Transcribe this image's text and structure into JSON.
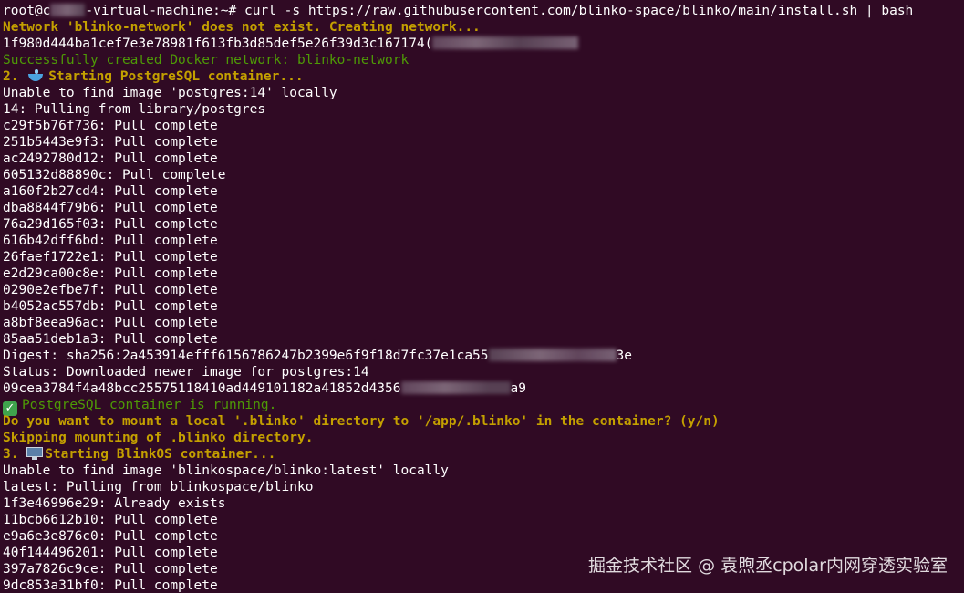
{
  "terminal": {
    "lines": [
      {
        "pre": "root@c",
        "post": "-virtual-machine:~# curl -s https://raw.githubusercontent.com/blinko-space/blinko/main/install.sh | bash"
      },
      {
        "text": "Network 'blinko-network' does not exist. Creating network..."
      },
      {
        "pre": "1f980d444ba1cef7e3e78981f613fb3d85def5e26f39d3c167174("
      },
      {
        "text": "Successfully created Docker network: blinko-network"
      },
      {
        "pre": "2. ",
        "post": "Starting PostgreSQL container..."
      },
      {
        "text": "Unable to find image 'postgres:14' locally"
      },
      {
        "text": "14: Pulling from library/postgres"
      },
      {
        "text": "c29f5b76f736: Pull complete"
      },
      {
        "text": "251b5443e9f3: Pull complete"
      },
      {
        "text": "ac2492780d12: Pull complete"
      },
      {
        "text": "605132d88890c: Pull complete"
      },
      {
        "text": "a160f2b27cd4: Pull complete"
      },
      {
        "text": "dba8844f79b6: Pull complete"
      },
      {
        "text": "76a29d165f03: Pull complete"
      },
      {
        "text": "616b42dff6bd: Pull complete"
      },
      {
        "text": "26faef1722e1: Pull complete"
      },
      {
        "text": "e2d29ca00c8e: Pull complete"
      },
      {
        "text": "0290e2efbe7f: Pull complete"
      },
      {
        "text": "b4052ac557db: Pull complete"
      },
      {
        "text": "a8bf8eea96ac: Pull complete"
      },
      {
        "text": "85aa51deb1a3: Pull complete"
      },
      {
        "pre": "Digest: sha256:2a453914efff6156786247b2399e6f9f18d7fc37e1ca55",
        "post": "3e"
      },
      {
        "text": "Status: Downloaded newer image for postgres:14"
      },
      {
        "pre": "09cea3784f4a48bcc25575118410ad449101182a41852d4356",
        "post": "a9"
      },
      {
        "text": "PostgreSQL container is running."
      },
      {
        "text": "Do you want to mount a local '.blinko' directory to '/app/.blinko' in the container? (y/n)"
      },
      {
        "text": "Skipping mounting of .blinko directory."
      },
      {
        "pre": "3. ",
        "post": "Starting BlinkOS container..."
      },
      {
        "text": "Unable to find image 'blinkospace/blinko:latest' locally"
      },
      {
        "text": "latest: Pulling from blinkospace/blinko"
      },
      {
        "text": "1f3e46996e29: Already exists"
      },
      {
        "text": "11bcb6612b10: Pull complete"
      },
      {
        "text": "e9a6e3e876c0: Pull complete"
      },
      {
        "text": "40f144496201: Pull complete"
      },
      {
        "text": "397a7826c9ce: Pull complete"
      },
      {
        "text": "9dc853a31bf0: Pull complete"
      }
    ],
    "check_glyph": "✓"
  },
  "watermark": "掘金技术社区 @ 袁煦丞cpolar内网穿透实验室",
  "colors": {
    "background": "#300a24",
    "normal": "#ffffff",
    "warning": "#c4a000",
    "success": "#4e9a06"
  },
  "icons": {
    "line_5": "whale-icon",
    "line_25": "check-mark-icon",
    "line_28": "desktop-computer-icon"
  }
}
